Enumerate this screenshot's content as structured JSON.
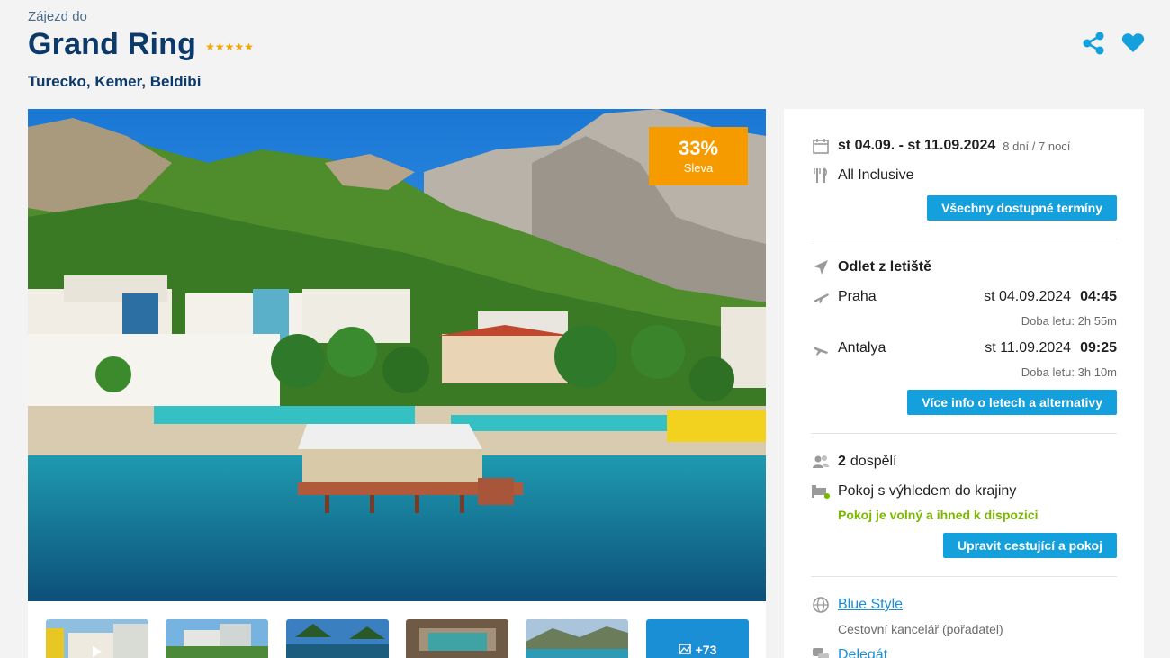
{
  "header": {
    "top_label": "Zájezd do",
    "title": "Grand Ring",
    "stars": "★★★★★",
    "location": "Turecko, Kemer, Beldibi"
  },
  "icons": {
    "share": "share-icon",
    "favorite": "heart-icon"
  },
  "discount": {
    "percent": "33%",
    "label": "Sleva"
  },
  "gallery": {
    "more_count": "+73"
  },
  "booking": {
    "dates": "st 04.09. - st 11.09.2024",
    "duration": "8 dní / 7 nocí",
    "board": "All Inclusive",
    "all_dates_button": "Všechny dostupné termíny",
    "departure_title": "Odlet z letiště",
    "outbound": {
      "city": "Praha",
      "date": "st 04.09.2024",
      "time": "04:45",
      "flight_time": "Doba letu: 2h 55m"
    },
    "inbound": {
      "city": "Antalya",
      "date": "st 11.09.2024",
      "time": "09:25",
      "flight_time": "Doba letu: 3h 10m"
    },
    "flights_button": "Více info o letech a alternativy",
    "travellers_count": "2",
    "travellers_label": "dospělí",
    "room": "Pokoj s výhledem do krajiny",
    "room_status": "Pokoj je volný a ihned k dispozici",
    "edit_button": "Upravit cestující a pokoj",
    "agency_name": "Blue Style",
    "agency_role": "Cestovní kancelář (pořadatel)",
    "delegate": "Delegát"
  },
  "colors": {
    "accent": "#14a0dc",
    "title": "#0b3a6a",
    "discount": "#f59b00",
    "available": "#7ab800"
  }
}
